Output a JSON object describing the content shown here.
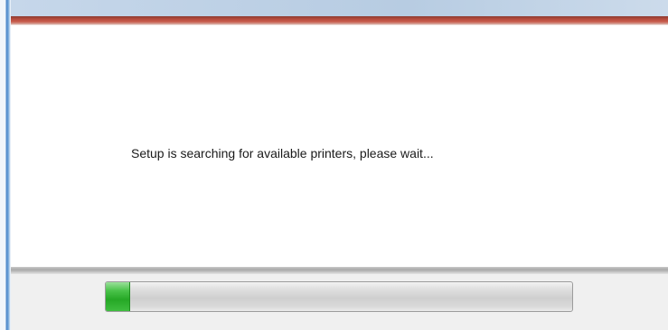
{
  "dialog": {
    "status_message": "Setup is searching for available printers, please wait..."
  },
  "progress": {
    "value_percent": 5,
    "color": "#26a826"
  },
  "colors": {
    "accent_bar": "#c85c4b",
    "footer_background": "#f0f0f0",
    "window_frame": "#4f88c9"
  }
}
